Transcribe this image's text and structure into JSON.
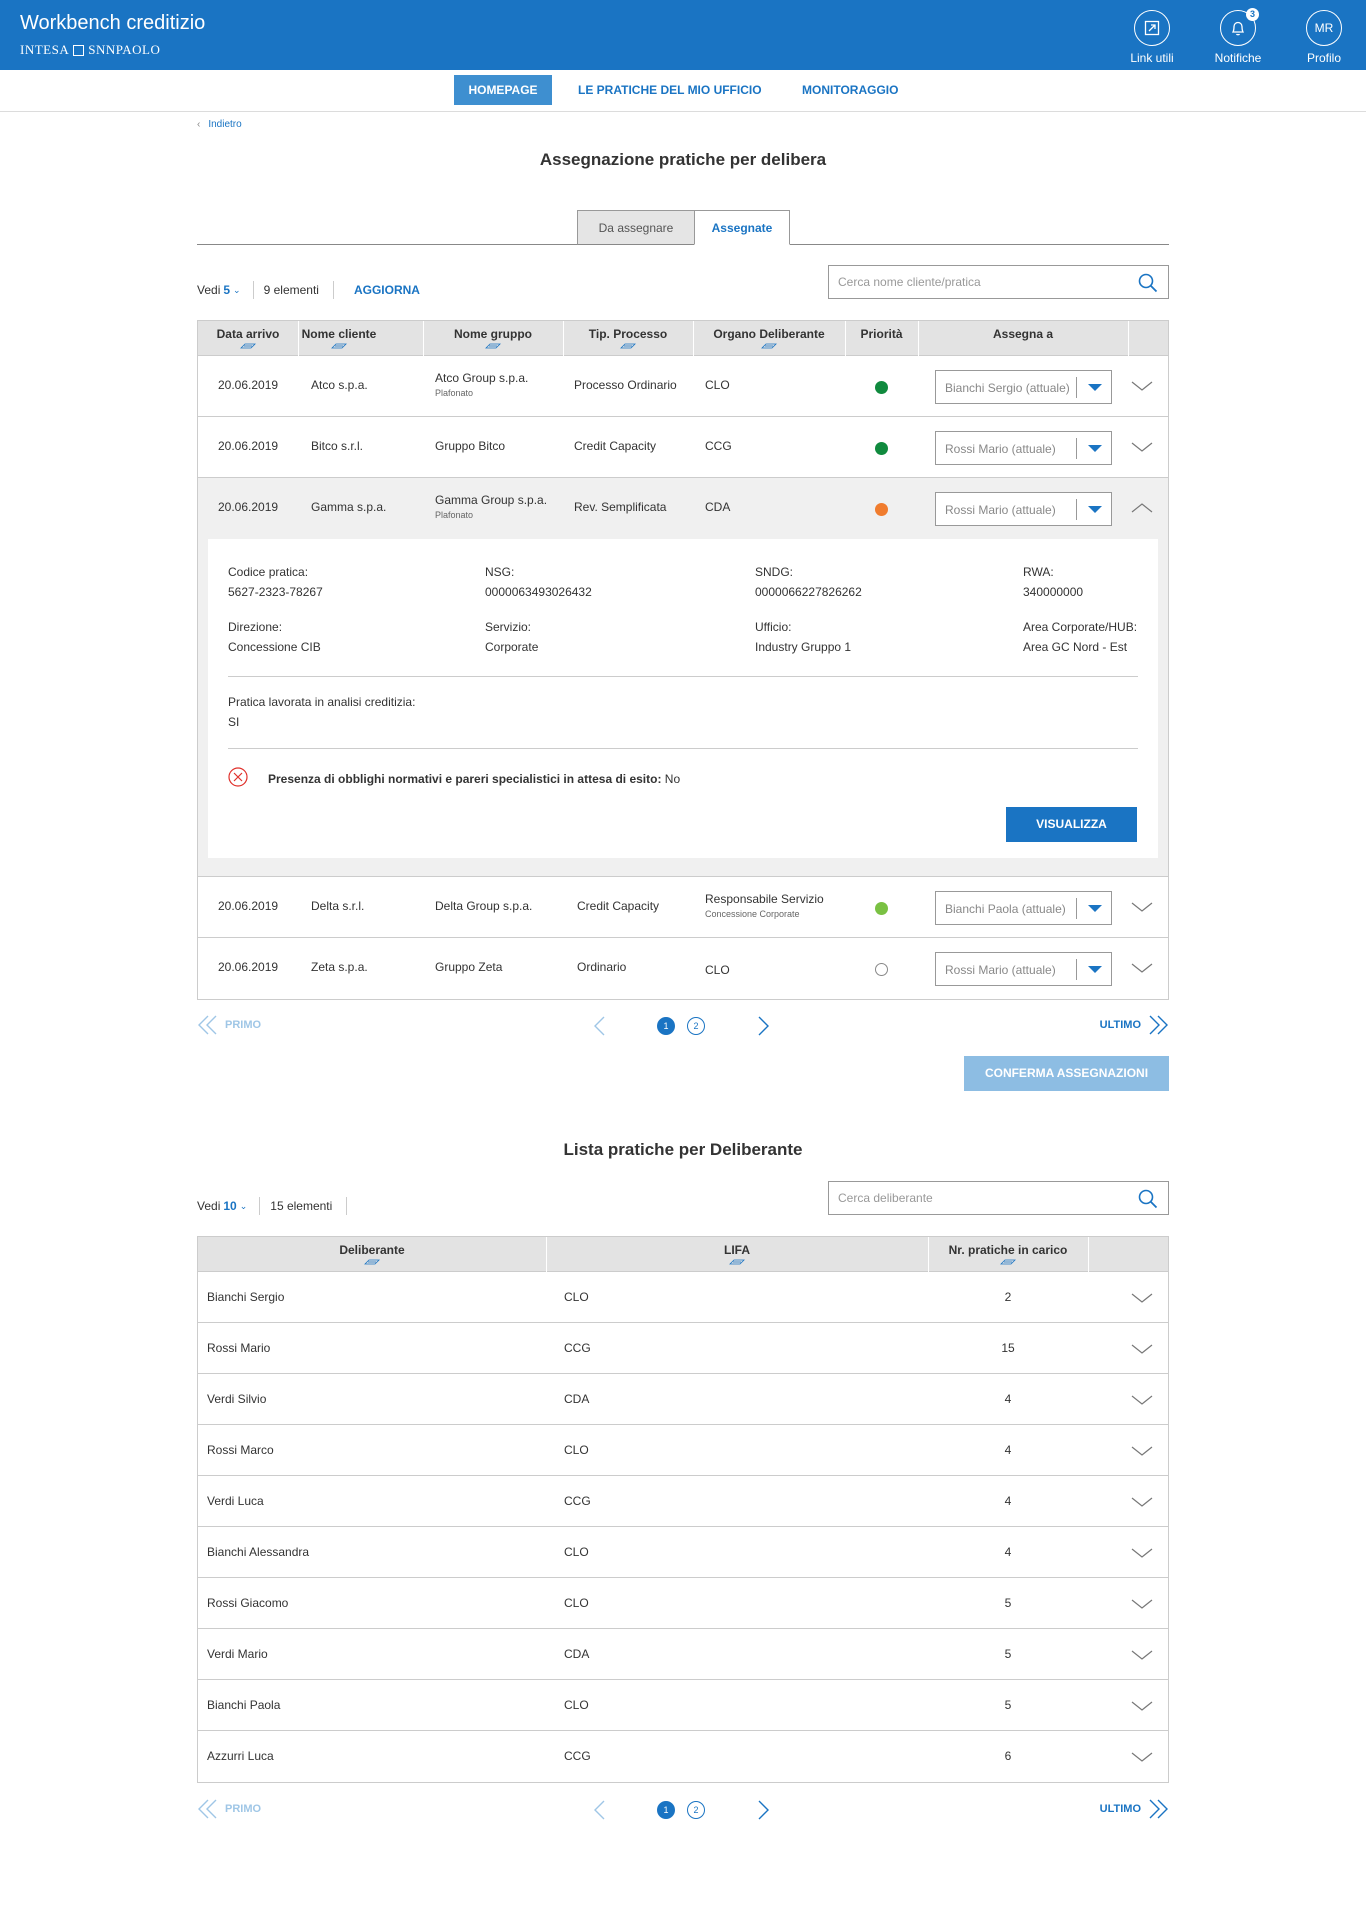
{
  "header": {
    "app_title": "Workbench creditizio",
    "brand_left": "INTESA",
    "brand_right": "SNNPAOLO",
    "link_utili": "Link utili",
    "notifiche": "Notifiche",
    "notifiche_count": "3",
    "profilo": "Profilo",
    "profile_initials": "MR"
  },
  "nav": {
    "items": [
      "HOMEPAGE",
      "LE PRATICHE DEL MIO UFFICIO",
      "MONITORAGGIO"
    ]
  },
  "back_label": "Indietro",
  "section1": {
    "title": "Assegnazione pratiche per delibera",
    "tabs": [
      "Da assegnare",
      "Assegnate"
    ],
    "vedi_label": "Vedi",
    "vedi_value": "5",
    "count": "9 elementi",
    "refresh": "AGGIORNA",
    "search_placeholder": "Cerca nome cliente/pratica",
    "columns": [
      "Data arrivo",
      "Nome cliente",
      "Nome gruppo",
      "Tip. Processo",
      "Organo Deliberante",
      "Priorità",
      "Assegna a"
    ],
    "rows": [
      {
        "data": "20.06.2019",
        "cliente": "Atco s.p.a.",
        "gruppo": "Atco Group s.p.a.",
        "gruppo_sub": "Plafonato",
        "processo": "Processo Ordinario",
        "organo": "CLO",
        "organo_sub": "",
        "priorita_color": "#108a3e",
        "assegna": "Bianchi Sergio (attuale)"
      },
      {
        "data": "20.06.2019",
        "cliente": "Bitco s.r.l.",
        "gruppo": "Gruppo Bitco",
        "gruppo_sub": "",
        "processo": "Credit Capacity",
        "organo": "CCG",
        "organo_sub": "",
        "priorita_color": "#108a3e",
        "assegna": "Rossi Mario (attuale)"
      },
      {
        "data": "20.06.2019",
        "cliente": "Gamma s.p.a.",
        "gruppo": "Gamma Group s.p.a.",
        "gruppo_sub": "Plafonato",
        "processo": "Rev. Semplificata",
        "organo": "CDA",
        "organo_sub": "",
        "priorita_color": "#f07c2e",
        "assegna": "Rossi Mario (attuale)"
      },
      {
        "data": "20.06.2019",
        "cliente": "Delta s.r.l.",
        "gruppo": "Delta Group s.p.a.",
        "gruppo_sub": "",
        "processo": "Credit Capacity",
        "organo": "Responsabile Servizio",
        "organo_sub": "Concessione Corporate",
        "priorita_color": "#7ac143",
        "assegna": "Bianchi Paola (attuale)"
      },
      {
        "data": "20.06.2019",
        "cliente": "Zeta s.p.a.",
        "gruppo": "Gruppo Zeta",
        "gruppo_sub": "",
        "processo": "Ordinario",
        "organo": "CLO",
        "organo_sub": "",
        "priorita_color": "",
        "assegna": "Rossi Mario (attuale)"
      }
    ],
    "detail": {
      "codice_label": "Codice pratica:",
      "codice": "5627-2323-78267",
      "nsg_label": "NSG:",
      "nsg": "0000063493026432",
      "sndg_label": "SNDG:",
      "sndg": "0000066227826262",
      "rwa_label": "RWA:",
      "rwa": "340000000",
      "direzione_label": "Direzione:",
      "direzione": "Concessione CIB",
      "servizio_label": "Servizio:",
      "servizio": "Corporate",
      "ufficio_label": "Ufficio:",
      "ufficio": "Industry Gruppo 1",
      "area_label": "Area Corporate/HUB:",
      "area": "Area GC Nord - Est",
      "analisi_label": "Pratica lavorata in analisi creditizia:",
      "analisi": "SI",
      "obblighi_label": "Presenza di obblighi normativi e pareri specialistici in attesa di esito:",
      "obblighi": "No",
      "button": "VISUALIZZA"
    },
    "pager": {
      "first": "PRIMO",
      "last": "ULTIMO",
      "pages": [
        "1",
        "2"
      ]
    },
    "confirm": "CONFERMA ASSEGNAZIONI"
  },
  "section2": {
    "title": "Lista pratiche per Deliberante",
    "vedi_label": "Vedi",
    "vedi_value": "10",
    "count": "15 elementi",
    "search_placeholder": "Cerca deliberante",
    "columns": [
      "Deliberante",
      "LIFA",
      "Nr. pratiche in carico"
    ],
    "rows": [
      {
        "nome": "Bianchi Sergio",
        "lifa": "CLO",
        "nr": "2"
      },
      {
        "nome": "Rossi Mario",
        "lifa": "CCG",
        "nr": "15"
      },
      {
        "nome": "Verdi Silvio",
        "lifa": "CDA",
        "nr": "4"
      },
      {
        "nome": "Rossi Marco",
        "lifa": "CLO",
        "nr": "4"
      },
      {
        "nome": "Verdi Luca",
        "lifa": "CCG",
        "nr": "4"
      },
      {
        "nome": "Bianchi Alessandra",
        "lifa": "CLO",
        "nr": "4"
      },
      {
        "nome": "Rossi Giacomo",
        "lifa": "CLO",
        "nr": "5"
      },
      {
        "nome": "Verdi Mario",
        "lifa": "CDA",
        "nr": "5"
      },
      {
        "nome": "Bianchi Paola",
        "lifa": "CLO",
        "nr": "5"
      },
      {
        "nome": "Azzurri Luca",
        "lifa": "CCG",
        "nr": "6"
      }
    ],
    "pager": {
      "first": "PRIMO",
      "last": "ULTIMO",
      "pages": [
        "1",
        "2"
      ]
    }
  },
  "colors": {
    "primary": "#1a74c3",
    "header_bg": "#1a74c3",
    "confirm_disabled": "#8dbde3"
  }
}
